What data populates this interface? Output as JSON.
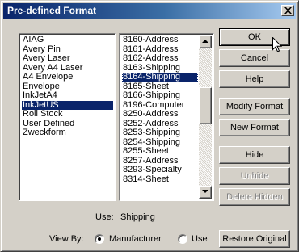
{
  "window": {
    "title": "Pre-defined Format"
  },
  "formats": {
    "items": [
      "AIAG",
      "Avery Pin",
      "Avery Laser",
      "Avery A4 Laser",
      "A4 Envelope",
      "Envelope",
      "InkJetA4",
      "InkJetUS",
      "Roll Stock",
      "User Defined",
      "Zweckform"
    ],
    "selected": "InkJetUS"
  },
  "labels": {
    "items": [
      "8160-Address",
      "8161-Address",
      "8162-Address",
      "8163-Shipping",
      "8164-Shipping",
      "8165-Sheet",
      "8166-Shipping",
      "8196-Computer",
      "8250-Address",
      "8252-Address",
      "8253-Shipping",
      "8254-Shipping",
      "8255-Sheet",
      "8257-Address",
      "8293-Specialty",
      "8314-Sheet"
    ],
    "selected": "8164-Shipping"
  },
  "buttons": {
    "ok": "OK",
    "cancel": "Cancel",
    "help": "Help",
    "modify_format": "Modify Format",
    "new_format": "New Format",
    "hide": "Hide",
    "unhide": "Unhide",
    "delete_hidden": "Delete Hidden",
    "restore_original": "Restore Original"
  },
  "use": {
    "label": "Use:",
    "value": "Shipping"
  },
  "view_by": {
    "label": "View By:",
    "options": [
      "Manufacturer",
      "Use"
    ],
    "selected": "Manufacturer"
  },
  "icons": [
    "close-icon",
    "scroll-up-arrow-icon",
    "scroll-down-arrow-icon",
    "mouse-pointer-icon"
  ]
}
